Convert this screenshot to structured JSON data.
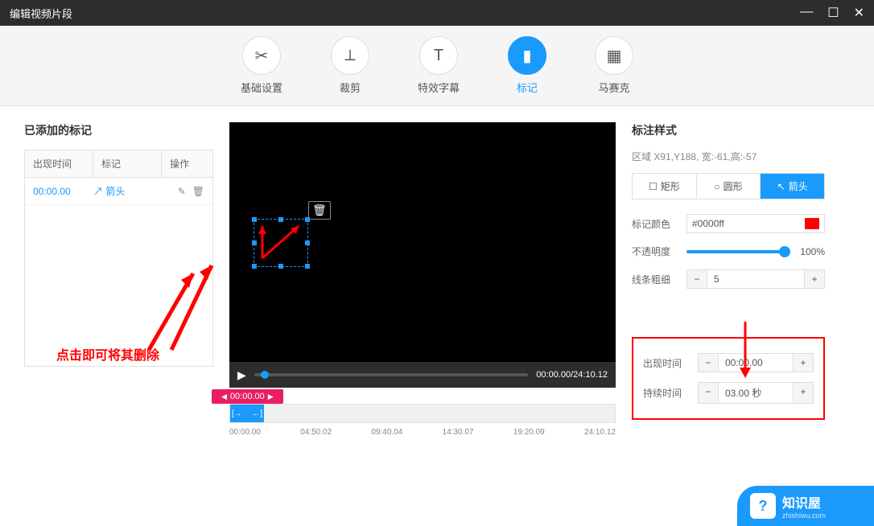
{
  "window": {
    "title": "编辑视频片段"
  },
  "toolbar": {
    "basic": "基础设置",
    "crop": "裁剪",
    "subtitle": "特效字幕",
    "mark": "标记",
    "mosaic": "马赛克"
  },
  "left": {
    "title": "已添加的标记",
    "cols": {
      "time": "出现时间",
      "mark": "标记",
      "action": "操作"
    },
    "row": {
      "time": "00:00.00",
      "mark": "箭头"
    }
  },
  "player": {
    "time": "00:00.00/24:10.12"
  },
  "timeline": {
    "flag": "00:00.00",
    "ticks": [
      "00:00.00",
      "04:50.02",
      "09:40.04",
      "14:30.07",
      "19:20.09",
      "24:10.12"
    ]
  },
  "right": {
    "title": "标注样式",
    "region": "区域 X91,Y188, 宽:-61,高:-57",
    "shapes": {
      "rect": "矩形",
      "circle": "圆形",
      "arrow": "箭头"
    },
    "colorLabel": "标记颜色",
    "colorValue": "#0000ff",
    "opacityLabel": "不透明度",
    "opacityValue": "100%",
    "thicknessLabel": "线条粗细",
    "thicknessValue": "5",
    "appearLabel": "出现时间",
    "appearValue": "00:00.00",
    "durationLabel": "持续时间",
    "durationValue": "03.00 秒"
  },
  "annotation": {
    "text": "点击即可将其删除"
  },
  "watermark": {
    "name": "知识屋",
    "sub": "zhishiwu.com"
  }
}
